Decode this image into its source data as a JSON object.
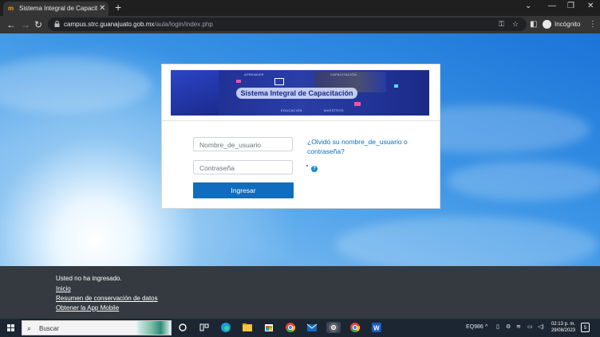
{
  "browser": {
    "tab_title": "Sistema Integral de Capacitación",
    "favicon_text": "m",
    "url_host": "campus.strc.guanajuato.gob.mx",
    "url_path": "/aula/login/index.php",
    "incognito_label": "Incógnito",
    "icons": [
      "back-icon",
      "forward-icon",
      "reload-icon",
      "lock-icon",
      "key-icon",
      "star-icon",
      "sidepanel-icon",
      "menu-icon"
    ]
  },
  "login": {
    "banner": {
      "title": "Sistema Integral de Capacitación",
      "left_tag": "APRENDER",
      "right_tag": "CAPACITACIÓN",
      "bottom_left": "EDUCACIÓN",
      "bottom_right": "MAESTROS"
    },
    "username_placeholder": "Nombre_de_usuario",
    "password_placeholder": "Contraseña",
    "submit_label": "Ingresar",
    "forgot_link": "¿Olvidó su nombre_de_usuario o contraseña?",
    "help_icon_text": "?"
  },
  "footer": {
    "status": "Usted no ha ingresado.",
    "links": [
      "Inicio",
      "Resumen de conservación de datos",
      "Obtener la App Mobile"
    ]
  },
  "taskbar": {
    "search_placeholder": "Buscar",
    "tray_label": "EQ986",
    "time": "02:13 p. m.",
    "date": "29/08/2023",
    "notification_count": "5",
    "apps": [
      "task-view-icon",
      "widgets-icon",
      "edge-icon",
      "file-explorer-icon",
      "store-icon",
      "chrome-icon",
      "mail-icon",
      "chrome-active-icon",
      "chrome-icon-2",
      "word-icon"
    ]
  }
}
